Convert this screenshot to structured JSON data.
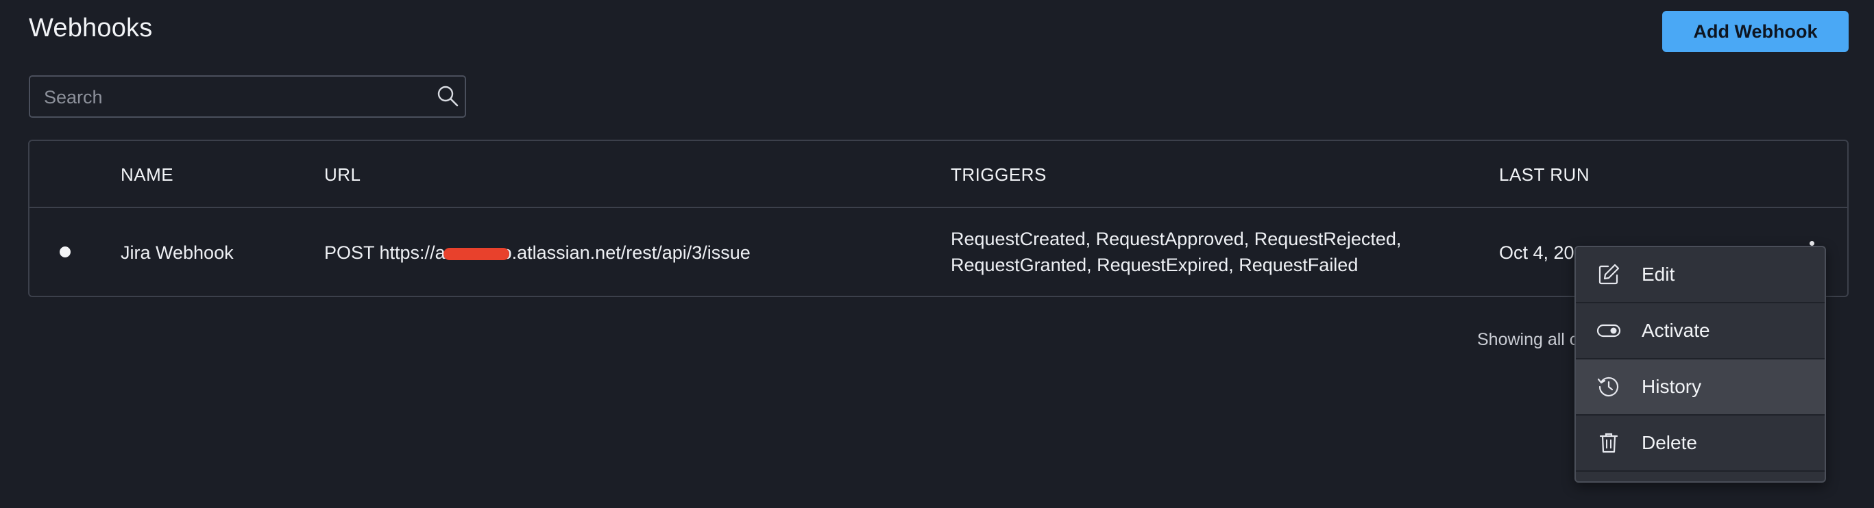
{
  "header": {
    "title": "Webhooks",
    "add_button": "Add Webhook"
  },
  "search": {
    "placeholder": "Search",
    "value": "",
    "icon": "search-icon"
  },
  "table": {
    "columns": [
      "NAME",
      "URL",
      "TRIGGERS",
      "LAST RUN"
    ],
    "rows": [
      {
        "status": "active",
        "name": "Jira Webhook",
        "url_prefix": "POST https://a",
        "url_suffix": "o.atlassian.net/rest/api/3/issue",
        "triggers_line1": "RequestCreated, RequestApproved, RequestRejected,",
        "triggers_line2": "RequestGranted, RequestExpired, RequestFailed",
        "last_run": "Oct 4, 20"
      }
    ]
  },
  "footer": {
    "showing_text": "Showing all c"
  },
  "context_menu": {
    "items": [
      {
        "label": "Edit",
        "icon": "edit-icon"
      },
      {
        "label": "Activate",
        "icon": "toggle-icon"
      },
      {
        "label": "History",
        "icon": "history-icon"
      },
      {
        "label": "Delete",
        "icon": "trash-icon"
      }
    ]
  },
  "colors": {
    "background": "#1b1e26",
    "accent": "#4aa8f5",
    "menu_background": "#2f323a",
    "redaction": "#e8412c"
  }
}
